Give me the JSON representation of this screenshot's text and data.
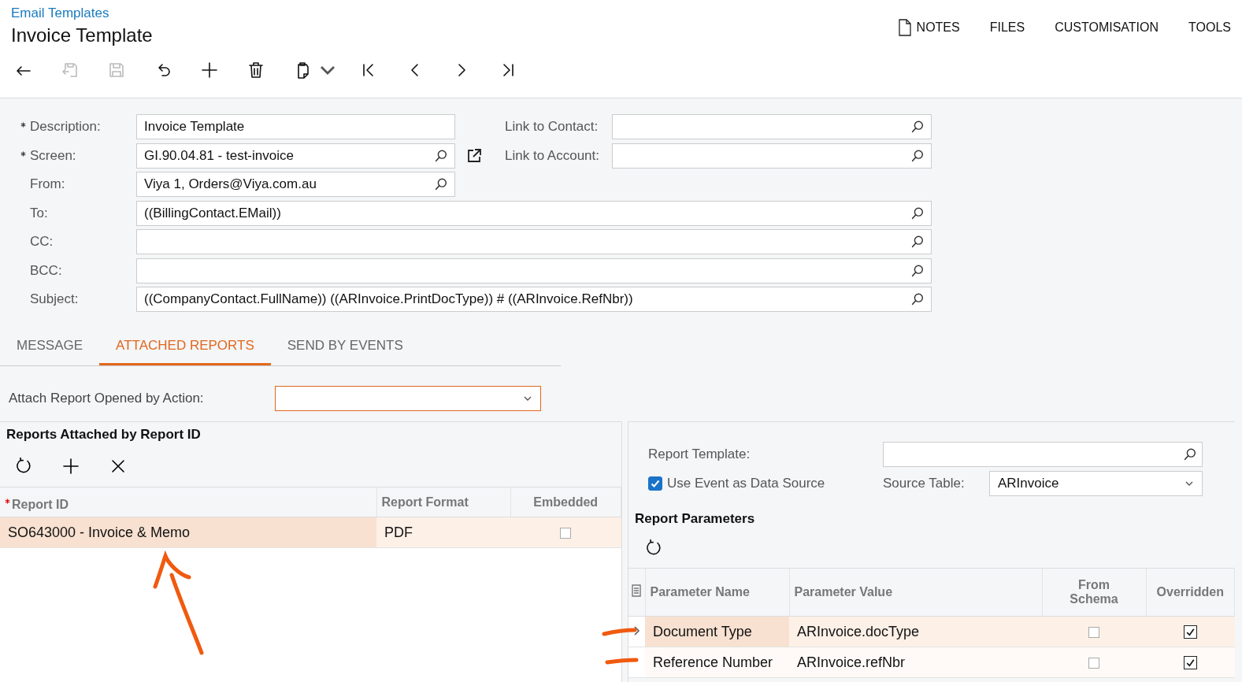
{
  "breadcrumb": "Email Templates",
  "title": "Invoice Template",
  "top_menu": [
    {
      "label": "NOTES",
      "kind": "notes"
    },
    {
      "label": "FILES",
      "kind": "plain"
    },
    {
      "label": "CUSTOMISATION",
      "kind": "plain"
    },
    {
      "label": "TOOLS",
      "kind": "plain"
    }
  ],
  "toolbar": [
    {
      "kind": "back",
      "disabled": false
    },
    {
      "kind": "save-close",
      "disabled": true
    },
    {
      "kind": "save",
      "disabled": true
    },
    {
      "kind": "undo",
      "disabled": false
    },
    {
      "kind": "add",
      "disabled": false
    },
    {
      "kind": "delete",
      "disabled": false
    },
    {
      "kind": "copy",
      "disabled": false
    },
    {
      "kind": "first",
      "disabled": false
    },
    {
      "kind": "prev",
      "disabled": false
    },
    {
      "kind": "next",
      "disabled": false
    },
    {
      "kind": "last",
      "disabled": false
    }
  ],
  "form": {
    "left_fields": [
      {
        "label": "Description:",
        "required": true,
        "value": "Invoice Template",
        "kind": "text"
      },
      {
        "label": "Screen:",
        "required": true,
        "value": "GI.90.04.81 - test-invoice",
        "kind": "lookup_link"
      },
      {
        "label": "From:",
        "required": false,
        "value": "Viya 1, Orders@Viya.com.au",
        "kind": "lookup"
      }
    ],
    "right_fields": [
      {
        "label": "Link to Contact:",
        "kind": "lookup"
      },
      {
        "label": "Link to Account:",
        "kind": "lookup"
      }
    ],
    "wide_fields": [
      {
        "label": "To:",
        "required": false,
        "value": "((BillingContact.EMail))",
        "kind": "lookup"
      },
      {
        "label": "CC:",
        "required": false,
        "kind": "lookup"
      },
      {
        "label": "BCC:",
        "required": false,
        "kind": "lookup"
      },
      {
        "label": "Subject:",
        "required": false,
        "value": "((CompanyContact.FullName)) ((ARInvoice.PrintDocType)) # ((ARInvoice.RefNbr))",
        "kind": "lookup"
      }
    ]
  },
  "tabs": [
    {
      "label": "MESSAGE",
      "selected": false
    },
    {
      "label": "ATTACHED REPORTS",
      "selected": true
    },
    {
      "label": "SEND BY EVENTS",
      "selected": false
    }
  ],
  "attach_action": {
    "label": "Attach Report Opened by Action:",
    "focused": true
  },
  "reports": {
    "title": "Reports Attached by Report ID",
    "toolbar": [
      {
        "kind": "refresh"
      },
      {
        "kind": "add"
      },
      {
        "kind": "delete"
      }
    ],
    "columns": [
      {
        "label": "Report ID",
        "required": true
      },
      {
        "label": "Report Format",
        "required": false
      },
      {
        "label": "Embedded",
        "required": false
      }
    ],
    "rows": [
      {
        "selected": true,
        "report_id": "SO643000 - Invoice & Memo",
        "format": "PDF",
        "embedded": false
      }
    ]
  },
  "report_settings": {
    "report_template": {
      "label": "Report Template:"
    },
    "use_event": {
      "label": "Use Event as Data Source",
      "checked": true
    },
    "source_table": {
      "label": "Source Table:",
      "value": "ARInvoice"
    }
  },
  "parameters": {
    "title": "Report Parameters",
    "toolbar": [
      {
        "kind": "refresh"
      }
    ],
    "columns": [
      {
        "label": "Parameter Name"
      },
      {
        "label": "Parameter Value"
      },
      {
        "label": "From Schema"
      },
      {
        "label": "Overridden"
      }
    ],
    "rows": [
      {
        "selected": true,
        "name": "Document Type",
        "value": "ARInvoice.docType",
        "from_schema": false,
        "overridden": true
      },
      {
        "selected": false,
        "name": "Reference Number",
        "value": "ARInvoice.refNbr",
        "from_schema": false,
        "overridden": true
      }
    ]
  }
}
